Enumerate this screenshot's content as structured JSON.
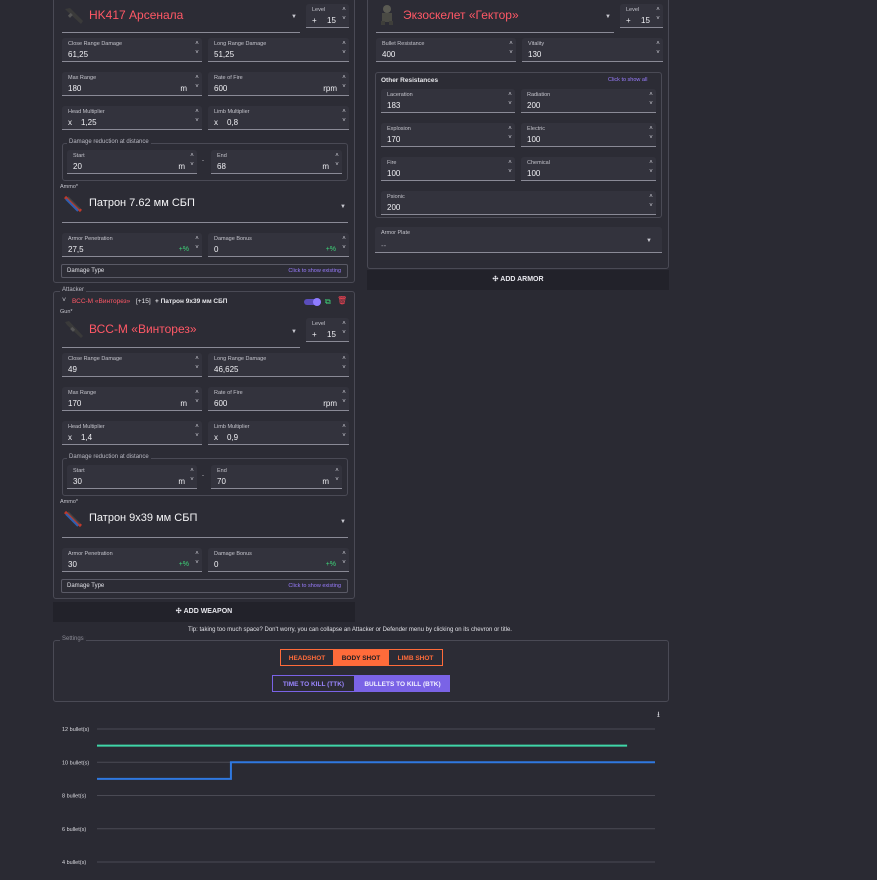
{
  "weapon1": {
    "name": "HK417 Арсенала",
    "level_label": "Level",
    "level_plus": "+",
    "level_value": "15",
    "close_range_label": "Close Range Damage",
    "close_range_value": "61,25",
    "long_range_label": "Long Range Damage",
    "long_range_value": "51,25",
    "max_range_label": "Max Range",
    "max_range_value": "180",
    "max_range_unit": "m",
    "rof_label": "Rate of Fire",
    "rof_value": "600",
    "rof_unit": "rpm",
    "head_mult_label": "Head Multiplier",
    "head_mult_prefix": "x",
    "head_mult_value": "1,25",
    "limb_mult_label": "Limb Multiplier",
    "limb_mult_prefix": "x",
    "limb_mult_value": "0,8",
    "reduction_legend": "Damage reduction at distance",
    "start_label": "Start",
    "start_value": "20",
    "start_unit": "m",
    "dash": "-",
    "end_label": "End",
    "end_value": "68",
    "end_unit": "m",
    "ammo_legend": "Ammo*",
    "ammo_name": "Патрон 7.62 мм СБП",
    "armor_pen_label": "Armor Penetration",
    "armor_pen_value": "27,5",
    "armor_pen_unit": "+%",
    "dmg_bonus_label": "Damage Bonus",
    "dmg_bonus_value": "0",
    "dmg_bonus_unit": "+%",
    "damage_type_label": "Damage Type",
    "damage_type_link": "Click to show existing"
  },
  "attacker2": {
    "legend": "Attacker",
    "header_name": "ВСС-М «Винторез»",
    "header_level": "[+15]",
    "header_ammo": "+ Патрон 9x39 мм СБП",
    "gun_legend": "Gun*",
    "name": "ВСС-М «Винторез»",
    "level_label": "Level",
    "level_plus": "+",
    "level_value": "15",
    "close_range_label": "Close Range Damage",
    "close_range_value": "49",
    "long_range_label": "Long Range Damage",
    "long_range_value": "46,625",
    "max_range_label": "Max Range",
    "max_range_value": "170",
    "max_range_unit": "m",
    "rof_label": "Rate of Fire",
    "rof_value": "600",
    "rof_unit": "rpm",
    "head_mult_label": "Head Multiplier",
    "head_mult_prefix": "x",
    "head_mult_value": "1,4",
    "limb_mult_label": "Limb Multiplier",
    "limb_mult_prefix": "x",
    "limb_mult_value": "0,9",
    "reduction_legend": "Damage reduction at distance",
    "start_label": "Start",
    "start_value": "30",
    "start_unit": "m",
    "dash": "-",
    "end_label": "End",
    "end_value": "70",
    "end_unit": "m",
    "ammo_legend": "Ammo*",
    "ammo_name": "Патрон 9x39 мм СБП",
    "armor_pen_label": "Armor Penetration",
    "armor_pen_value": "30",
    "armor_pen_unit": "+%",
    "dmg_bonus_label": "Damage Bonus",
    "dmg_bonus_value": "0",
    "dmg_bonus_unit": "+%",
    "damage_type_label": "Damage Type",
    "damage_type_link": "Click to show existing"
  },
  "add_weapon_label": "ADD WEAPON",
  "armor": {
    "name": "Экзоскелет «Гектор»",
    "level_label": "Level",
    "level_plus": "+",
    "level_value": "15",
    "bullet_res_label": "Bullet Resistance",
    "bullet_res_value": "400",
    "vitality_label": "Vitality",
    "vitality_value": "130",
    "other_res_label": "Other Resistances",
    "other_res_link": "Click to show all",
    "laceration_label": "Laceration",
    "laceration_value": "183",
    "radiation_label": "Radiation",
    "radiation_value": "200",
    "explosion_label": "Explosion",
    "explosion_value": "170",
    "electric_label": "Electric",
    "electric_value": "100",
    "fire_label": "Fire",
    "fire_value": "100",
    "chemical_label": "Chemical",
    "chemical_value": "100",
    "psionic_label": "Psionic",
    "psionic_value": "200",
    "armor_plate_label": "Armor Plate",
    "armor_plate_value": "--"
  },
  "add_armor_label": "ADD ARMOR",
  "tip": "Tip: taking too much space? Don't worry, you can collapse an Attacker or Defender menu by clicking on its chevron or title.",
  "settings": {
    "legend": "Settings",
    "headshot": "HEADSHOT",
    "bodyshot": "BODY SHOT",
    "limbshot": "LIMB SHOT",
    "ttk": "TIME TO KILL (TTK)",
    "btk": "BULLETS TO KILL (BTK)"
  },
  "colors": {
    "accent_orange": "#ff6b3a",
    "accent_purple": "#7a63e6",
    "name_red": "#ff5866",
    "series_teal": "#3fd6a8",
    "series_blue": "#2f78e0"
  },
  "chart_data": {
    "type": "line",
    "y_ticks": [
      "12 bullet(s)",
      "10 bullet(s)",
      "8 bullet(s)",
      "6 bullet(s)",
      "4 bullet(s)"
    ],
    "y_tick_values": [
      12,
      10,
      8,
      6,
      4
    ],
    "ylim": [
      4,
      12
    ],
    "xlim": [
      0,
      100
    ],
    "grid": true,
    "series": [
      {
        "color": "#3fd6a8",
        "x": [
          0,
          95
        ],
        "y": [
          11,
          11
        ]
      },
      {
        "color": "#2f78e0",
        "x": [
          0,
          24,
          24,
          100
        ],
        "y": [
          9,
          9,
          10,
          10
        ]
      }
    ]
  }
}
